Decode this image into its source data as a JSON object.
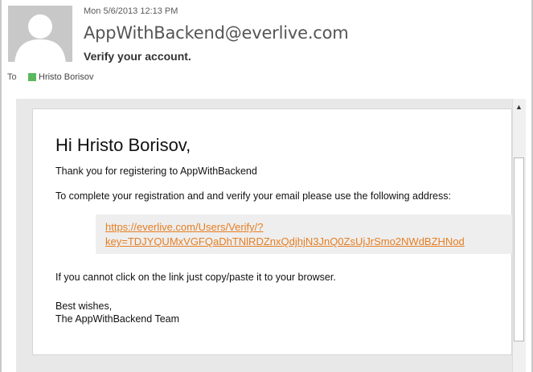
{
  "header": {
    "date": "Mon 5/6/2013 12:13 PM",
    "from": "AppWithBackend@everlive.com",
    "subject": "Verify your account.",
    "to_label": "To",
    "recipient": "Hristo Borisov",
    "avatar_icon": "person-silhouette-icon",
    "presence_color": "#5cb85c"
  },
  "email": {
    "greeting": "Hi Hristo Borisov,",
    "thanks": "Thank you for registering to AppWithBackend",
    "instruction": "To complete your registration and and verify your email please use the following address:",
    "link_line1": "https://everlive.com/Users/Verify/?",
    "link_line2": "key=TDJYQUMxVGFQaDhTNlRDZnxQdjhjN3JnQ0ZsUjJrSmo2NWdBZHNod",
    "link_color": "#e67e22",
    "copy_hint": "If you cannot click on the link just copy/paste it to your browser.",
    "closing": "Best wishes,",
    "team": "The AppWithBackend Team"
  },
  "scrollbar": {
    "up_arrow_icon": "scroll-up-arrow-icon"
  }
}
